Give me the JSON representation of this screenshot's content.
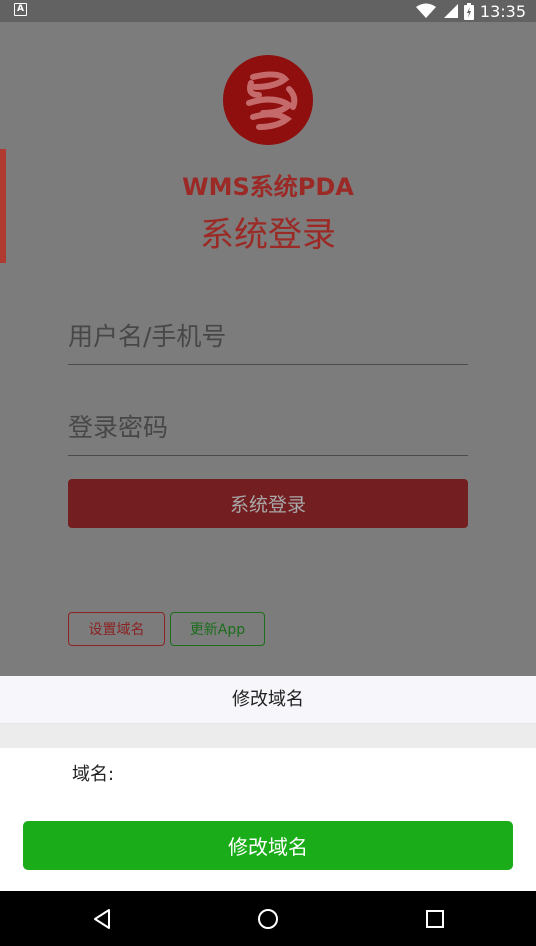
{
  "status_bar": {
    "time": "13:35",
    "app_icon_letter": "A",
    "icons": [
      "wifi-icon",
      "signal-icon",
      "battery-icon"
    ]
  },
  "login": {
    "app_title": "WMS系统PDA",
    "title": "系统登录",
    "username_placeholder": "用户名/手机号",
    "password_placeholder": "登录密码",
    "login_button": "系统登录",
    "set_domain_button": "设置域名",
    "update_app_button": "更新App"
  },
  "sheet": {
    "title": "修改域名",
    "domain_label": "域名:",
    "domain_value": "",
    "submit_button": "修改域名"
  },
  "colors": {
    "brand_red": "#9b2a26",
    "confirm_green": "#1aad19",
    "overlay_gray": "#7c7c7c"
  },
  "nav_bar": {
    "icons": [
      "back-icon",
      "home-icon",
      "recent-apps-icon"
    ]
  }
}
